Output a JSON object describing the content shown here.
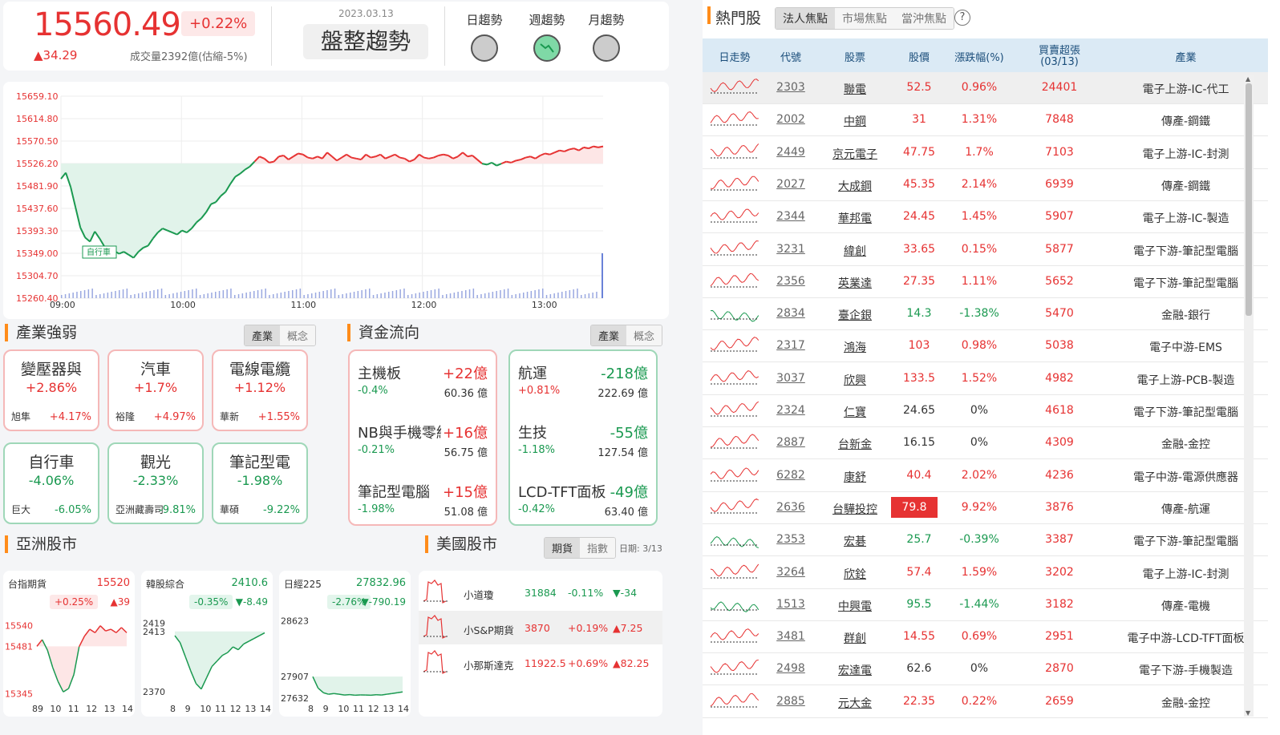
{
  "index": {
    "value": "15560.49",
    "pct": "+0.22%",
    "change": "▲34.29",
    "volume": "成交量2392億(估縮-5%)"
  },
  "trend": {
    "date": "2023.03.13",
    "label": "盤整趨勢",
    "items": [
      {
        "label": "日趨勢",
        "state": "neutral"
      },
      {
        "label": "週趨勢",
        "state": "down"
      },
      {
        "label": "月趨勢",
        "state": "neutral"
      }
    ]
  },
  "intraday": {
    "y_ticks": [
      "15659.10",
      "15614.80",
      "15570.50",
      "15526.20",
      "15481.90",
      "15437.60",
      "15393.30",
      "15349.00",
      "15304.70",
      "15260.40"
    ],
    "x_ticks": [
      "09:00",
      "10:00",
      "11:00",
      "12:00",
      "13:00"
    ],
    "ref_value": 15526.2,
    "annotation": "自行車",
    "points": [
      [
        0,
        15496
      ],
      [
        6,
        15508
      ],
      [
        12,
        15480
      ],
      [
        18,
        15440
      ],
      [
        24,
        15400
      ],
      [
        30,
        15380
      ],
      [
        36,
        15372
      ],
      [
        42,
        15392
      ],
      [
        48,
        15378
      ],
      [
        54,
        15362
      ],
      [
        60,
        15356
      ],
      [
        66,
        15354
      ],
      [
        72,
        15348
      ],
      [
        78,
        15352
      ],
      [
        84,
        15346
      ],
      [
        90,
        15340
      ],
      [
        96,
        15352
      ],
      [
        102,
        15360
      ],
      [
        108,
        15364
      ],
      [
        114,
        15378
      ],
      [
        120,
        15390
      ],
      [
        126,
        15398
      ],
      [
        132,
        15394
      ],
      [
        138,
        15390
      ],
      [
        144,
        15386
      ],
      [
        150,
        15394
      ],
      [
        156,
        15390
      ],
      [
        162,
        15398
      ],
      [
        168,
        15410
      ],
      [
        174,
        15418
      ],
      [
        180,
        15430
      ],
      [
        186,
        15446
      ],
      [
        192,
        15450
      ],
      [
        198,
        15462
      ],
      [
        204,
        15470
      ],
      [
        210,
        15486
      ],
      [
        216,
        15500
      ],
      [
        222,
        15506
      ],
      [
        228,
        15514
      ],
      [
        234,
        15520
      ],
      [
        240,
        15530
      ],
      [
        246,
        15540
      ],
      [
        252,
        15536
      ],
      [
        258,
        15528
      ],
      [
        264,
        15530
      ],
      [
        270,
        15540
      ],
      [
        276,
        15542
      ],
      [
        282,
        15534
      ],
      [
        288,
        15540
      ],
      [
        294,
        15546
      ],
      [
        300,
        15544
      ],
      [
        306,
        15538
      ],
      [
        312,
        15536
      ],
      [
        318,
        15540
      ],
      [
        324,
        15536
      ],
      [
        330,
        15548
      ],
      [
        336,
        15540
      ],
      [
        342,
        15532
      ],
      [
        348,
        15538
      ],
      [
        354,
        15544
      ],
      [
        360,
        15538
      ],
      [
        366,
        15536
      ],
      [
        372,
        15534
      ],
      [
        378,
        15544
      ],
      [
        384,
        15538
      ],
      [
        390,
        15540
      ],
      [
        396,
        15544
      ],
      [
        402,
        15536
      ],
      [
        408,
        15540
      ],
      [
        414,
        15544
      ],
      [
        420,
        15538
      ],
      [
        426,
        15536
      ],
      [
        432,
        15530
      ],
      [
        438,
        15534
      ],
      [
        444,
        15544
      ],
      [
        450,
        15538
      ],
      [
        456,
        15536
      ],
      [
        462,
        15538
      ],
      [
        468,
        15542
      ],
      [
        474,
        15544
      ],
      [
        480,
        15542
      ],
      [
        486,
        15536
      ],
      [
        492,
        15540
      ],
      [
        498,
        15548
      ],
      [
        504,
        15540
      ],
      [
        510,
        15542
      ],
      [
        516,
        15534
      ],
      [
        522,
        15526
      ],
      [
        528,
        15524
      ],
      [
        534,
        15528
      ],
      [
        540,
        15522
      ],
      [
        546,
        15526
      ],
      [
        552,
        15530
      ],
      [
        558,
        15528
      ],
      [
        564,
        15532
      ],
      [
        570,
        15534
      ],
      [
        576,
        15538
      ],
      [
        582,
        15540
      ],
      [
        588,
        15536
      ],
      [
        594,
        15542
      ],
      [
        600,
        15546
      ],
      [
        606,
        15544
      ],
      [
        612,
        15548
      ],
      [
        618,
        15552
      ],
      [
        624,
        15550
      ],
      [
        630,
        15554
      ],
      [
        636,
        15556
      ],
      [
        642,
        15552
      ],
      [
        648,
        15558
      ],
      [
        654,
        15556
      ],
      [
        660,
        15560
      ],
      [
        666,
        15558
      ],
      [
        672,
        15560
      ]
    ]
  },
  "industry": {
    "title": "產業強弱",
    "tabs": [
      "產業",
      "概念"
    ],
    "items": [
      {
        "name": "變壓器與",
        "pct": "+2.86%",
        "stock": "旭隼",
        "spct": "+4.17%",
        "dir": "up"
      },
      {
        "name": "汽車",
        "pct": "+1.7%",
        "stock": "裕隆",
        "spct": "+4.97%",
        "dir": "up"
      },
      {
        "name": "電線電纜",
        "pct": "+1.12%",
        "stock": "華新",
        "spct": "+1.55%",
        "dir": "up"
      },
      {
        "name": "自行車",
        "pct": "-4.06%",
        "stock": "巨大",
        "spct": "-6.05%",
        "dir": "dn"
      },
      {
        "name": "觀光",
        "pct": "-2.33%",
        "stock": "亞洲藏壽司",
        "spct": "-9.81%",
        "dir": "dn"
      },
      {
        "name": "筆記型電",
        "pct": "-1.98%",
        "stock": "華碩",
        "spct": "-9.22%",
        "dir": "dn"
      }
    ]
  },
  "fund": {
    "title": "資金流向",
    "tabs": [
      "產業",
      "概念"
    ],
    "inflow": [
      {
        "name": "主機板",
        "value": "+22億",
        "pct": "-0.4%",
        "amt": "60.36 億"
      },
      {
        "name": "NB與手機零組件",
        "value": "+16億",
        "pct": "-0.21%",
        "amt": "56.75 億"
      },
      {
        "name": "筆記型電腦",
        "value": "+15億",
        "pct": "-1.98%",
        "amt": "51.08 億"
      }
    ],
    "outflow": [
      {
        "name": "航運",
        "value": "-218億",
        "pct": "+0.81%",
        "amt": "222.69 億"
      },
      {
        "name": "生技",
        "value": "-55億",
        "pct": "-1.18%",
        "amt": "127.54 億"
      },
      {
        "name": "LCD-TFT面板",
        "value": "-49億",
        "pct": "-0.42%",
        "amt": "63.40 億"
      }
    ]
  },
  "asia": {
    "title": "亞洲股市",
    "cards": [
      {
        "name": "台指期貨",
        "value": "15520",
        "pct": "+0.25%",
        "chg": "▲39",
        "dir": "up",
        "y_top": "15540",
        "y_mid": "15481",
        "y_bot": "15345",
        "x": [
          "89",
          "10",
          "11",
          "12",
          "13",
          "14"
        ]
      },
      {
        "name": "韓股綜合",
        "value": "2410.6",
        "pct": "-0.35%",
        "chg": "▼-8.49",
        "dir": "dn",
        "y_top": "2419",
        "y_mid": "2413",
        "y_bot": "2370",
        "x": [
          "8",
          "9",
          "10",
          "11",
          "12",
          "13",
          "14"
        ]
      },
      {
        "name": "日經225",
        "value": "27832.96",
        "pct": "-2.76%",
        "chg": "▼-790.19",
        "dir": "dn",
        "y_top": "28623",
        "y_mid": "27907",
        "y_bot": "27632",
        "x": [
          "8",
          "9",
          "10",
          "11",
          "12",
          "13",
          "14"
        ]
      }
    ]
  },
  "us": {
    "title": "美國股市",
    "tabs": [
      "期貨",
      "指數"
    ],
    "date": "日期: 3/13",
    "rows": [
      {
        "name": "小道瓊",
        "value": "31884",
        "pct": "-0.11%",
        "chg": "▼-34",
        "dir": "dn"
      },
      {
        "name": "小S&P期貨",
        "value": "3870",
        "pct": "+0.19%",
        "chg": "▲7.25",
        "dir": "up"
      },
      {
        "name": "小那斯達克",
        "value": "11922.5",
        "pct": "+0.69%",
        "chg": "▲82.25",
        "dir": "up"
      }
    ]
  },
  "hot": {
    "title": "熱門股",
    "tabs": [
      "法人焦點",
      "市場焦點",
      "當沖焦點"
    ],
    "help": "?",
    "headers": [
      "日走勢",
      "代號",
      "股票",
      "股價",
      "漲跌幅(%)",
      "買賣超張",
      "(03/13)",
      "產業"
    ],
    "rows": [
      {
        "code": "2303",
        "name": "聯電",
        "price": "52.5",
        "pct": "0.96%",
        "vol": "24401",
        "ind": "電子上游-IC-代工",
        "dir": "up"
      },
      {
        "code": "2002",
        "name": "中鋼",
        "price": "31",
        "pct": "1.31%",
        "vol": "7848",
        "ind": "傳產-鋼鐵",
        "dir": "up"
      },
      {
        "code": "2449",
        "name": "京元電子",
        "price": "47.75",
        "pct": "1.7%",
        "vol": "7103",
        "ind": "電子上游-IC-封測",
        "dir": "up"
      },
      {
        "code": "2027",
        "name": "大成鋼",
        "price": "45.35",
        "pct": "2.14%",
        "vol": "6939",
        "ind": "傳產-鋼鐵",
        "dir": "up"
      },
      {
        "code": "2344",
        "name": "華邦電",
        "price": "24.45",
        "pct": "1.45%",
        "vol": "5907",
        "ind": "電子上游-IC-製造",
        "dir": "up"
      },
      {
        "code": "3231",
        "name": "緯創",
        "price": "33.65",
        "pct": "0.15%",
        "vol": "5877",
        "ind": "電子下游-筆記型電腦",
        "dir": "up"
      },
      {
        "code": "2356",
        "name": "英業達",
        "price": "27.35",
        "pct": "1.11%",
        "vol": "5652",
        "ind": "電子下游-筆記型電腦",
        "dir": "up"
      },
      {
        "code": "2834",
        "name": "臺企銀",
        "price": "14.3",
        "pct": "-1.38%",
        "vol": "5470",
        "ind": "金融-銀行",
        "dir": "dn"
      },
      {
        "code": "2317",
        "name": "鴻海",
        "price": "103",
        "pct": "0.98%",
        "vol": "5038",
        "ind": "電子中游-EMS",
        "dir": "up"
      },
      {
        "code": "3037",
        "name": "欣興",
        "price": "133.5",
        "pct": "1.52%",
        "vol": "4982",
        "ind": "電子上游-PCB-製造",
        "dir": "up"
      },
      {
        "code": "2324",
        "name": "仁寶",
        "price": "24.65",
        "pct": "0%",
        "vol": "4618",
        "ind": "電子下游-筆記型電腦",
        "dir": "flat"
      },
      {
        "code": "2887",
        "name": "台新金",
        "price": "16.15",
        "pct": "0%",
        "vol": "4309",
        "ind": "金融-金控",
        "dir": "flat"
      },
      {
        "code": "6282",
        "name": "康舒",
        "price": "40.4",
        "pct": "2.02%",
        "vol": "4236",
        "ind": "電子中游-電源供應器",
        "dir": "up"
      },
      {
        "code": "2636",
        "name": "台驊投控",
        "price": "79.8",
        "pct": "9.92%",
        "vol": "3876",
        "ind": "傳產-航運",
        "dir": "limit"
      },
      {
        "code": "2353",
        "name": "宏碁",
        "price": "25.7",
        "pct": "-0.39%",
        "vol": "3387",
        "ind": "電子下游-筆記型電腦",
        "dir": "dn"
      },
      {
        "code": "3264",
        "name": "欣銓",
        "price": "57.4",
        "pct": "1.59%",
        "vol": "3202",
        "ind": "電子上游-IC-封測",
        "dir": "up"
      },
      {
        "code": "1513",
        "name": "中興電",
        "price": "95.5",
        "pct": "-1.44%",
        "vol": "3182",
        "ind": "傳產-電機",
        "dir": "dn"
      },
      {
        "code": "3481",
        "name": "群創",
        "price": "14.55",
        "pct": "0.69%",
        "vol": "2951",
        "ind": "電子中游-LCD-TFT面板",
        "dir": "up"
      },
      {
        "code": "2498",
        "name": "宏達電",
        "price": "62.6",
        "pct": "0%",
        "vol": "2870",
        "ind": "電子下游-手機製造",
        "dir": "flat"
      },
      {
        "code": "2885",
        "name": "元大金",
        "price": "22.35",
        "pct": "0.22%",
        "vol": "2659",
        "ind": "金融-金控",
        "dir": "up"
      }
    ]
  },
  "colors": {
    "up": "#e63232",
    "down": "#1a9950",
    "accent": "#ff8c1a",
    "header_bg": "#dbeaf5"
  }
}
